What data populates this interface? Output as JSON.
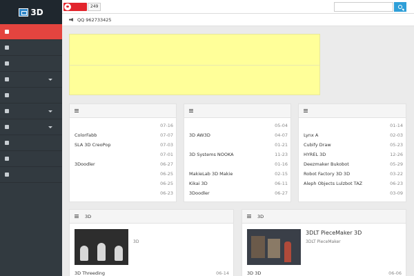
{
  "header": {
    "logo_text": "3D",
    "follower_count": "249",
    "search_placeholder": ""
  },
  "notice": "QQ 962733425",
  "sidebar": [
    {
      "label": "",
      "has_caret": false
    },
    {
      "label": "",
      "has_caret": false
    },
    {
      "label": "",
      "has_caret": false
    },
    {
      "label": "",
      "has_caret": true
    },
    {
      "label": "",
      "has_caret": false
    },
    {
      "label": "",
      "has_caret": true
    },
    {
      "label": "",
      "has_caret": true
    },
    {
      "label": "",
      "has_caret": false
    },
    {
      "label": "",
      "has_caret": false
    },
    {
      "label": "",
      "has_caret": false
    }
  ],
  "panels": [
    {
      "title": "",
      "items": [
        {
          "title": "",
          "date": "07-16"
        },
        {
          "title": "ColorFabb",
          "date": "07-07"
        },
        {
          "title": "SLA 3D CreoPop",
          "date": "07-03"
        },
        {
          "title": "",
          "date": "07-01"
        },
        {
          "title": "3Doodler",
          "date": "06-27"
        },
        {
          "title": "",
          "date": "06-25"
        },
        {
          "title": "",
          "date": "06-25"
        },
        {
          "title": "",
          "date": "06-23"
        }
      ]
    },
    {
      "title": "",
      "items": [
        {
          "title": "",
          "date": "05-04"
        },
        {
          "title": "3D AW3D",
          "date": "04-07"
        },
        {
          "title": "",
          "date": "01-21"
        },
        {
          "title": "3D Systems NOOKA",
          "date": "11-23"
        },
        {
          "title": "",
          "date": "01-16"
        },
        {
          "title": "MakieLab 3D Makie",
          "date": "02-15"
        },
        {
          "title": "Kikai 3D",
          "date": "06-11"
        },
        {
          "title": "3Doodler",
          "date": "06-27"
        }
      ]
    },
    {
      "title": "",
      "items": [
        {
          "title": "",
          "date": "01-14"
        },
        {
          "title": "Lynx A",
          "date": "02-03"
        },
        {
          "title": "Cubify Draw",
          "date": "05-23"
        },
        {
          "title": "HYREL 3D",
          "date": "12-26"
        },
        {
          "title": "Deezmaker Bukobot",
          "date": "05-29"
        },
        {
          "title": "Robot Factory 3D 3D",
          "date": "03-22"
        },
        {
          "title": "Aleph Objects Lulzbot TAZ",
          "date": "06-23"
        },
        {
          "title": "",
          "date": "03-09"
        }
      ]
    }
  ],
  "articles": [
    {
      "tab": "3D",
      "headline": "",
      "summary": "3D",
      "footer_item": "3D Threeding",
      "footer_date": "06-14"
    },
    {
      "tab": "3D",
      "headline": "3DLT PieceMaker 3D",
      "summary": "3DLT PieceMaker",
      "footer_item": "3D 3D",
      "footer_date": "06-06"
    }
  ]
}
